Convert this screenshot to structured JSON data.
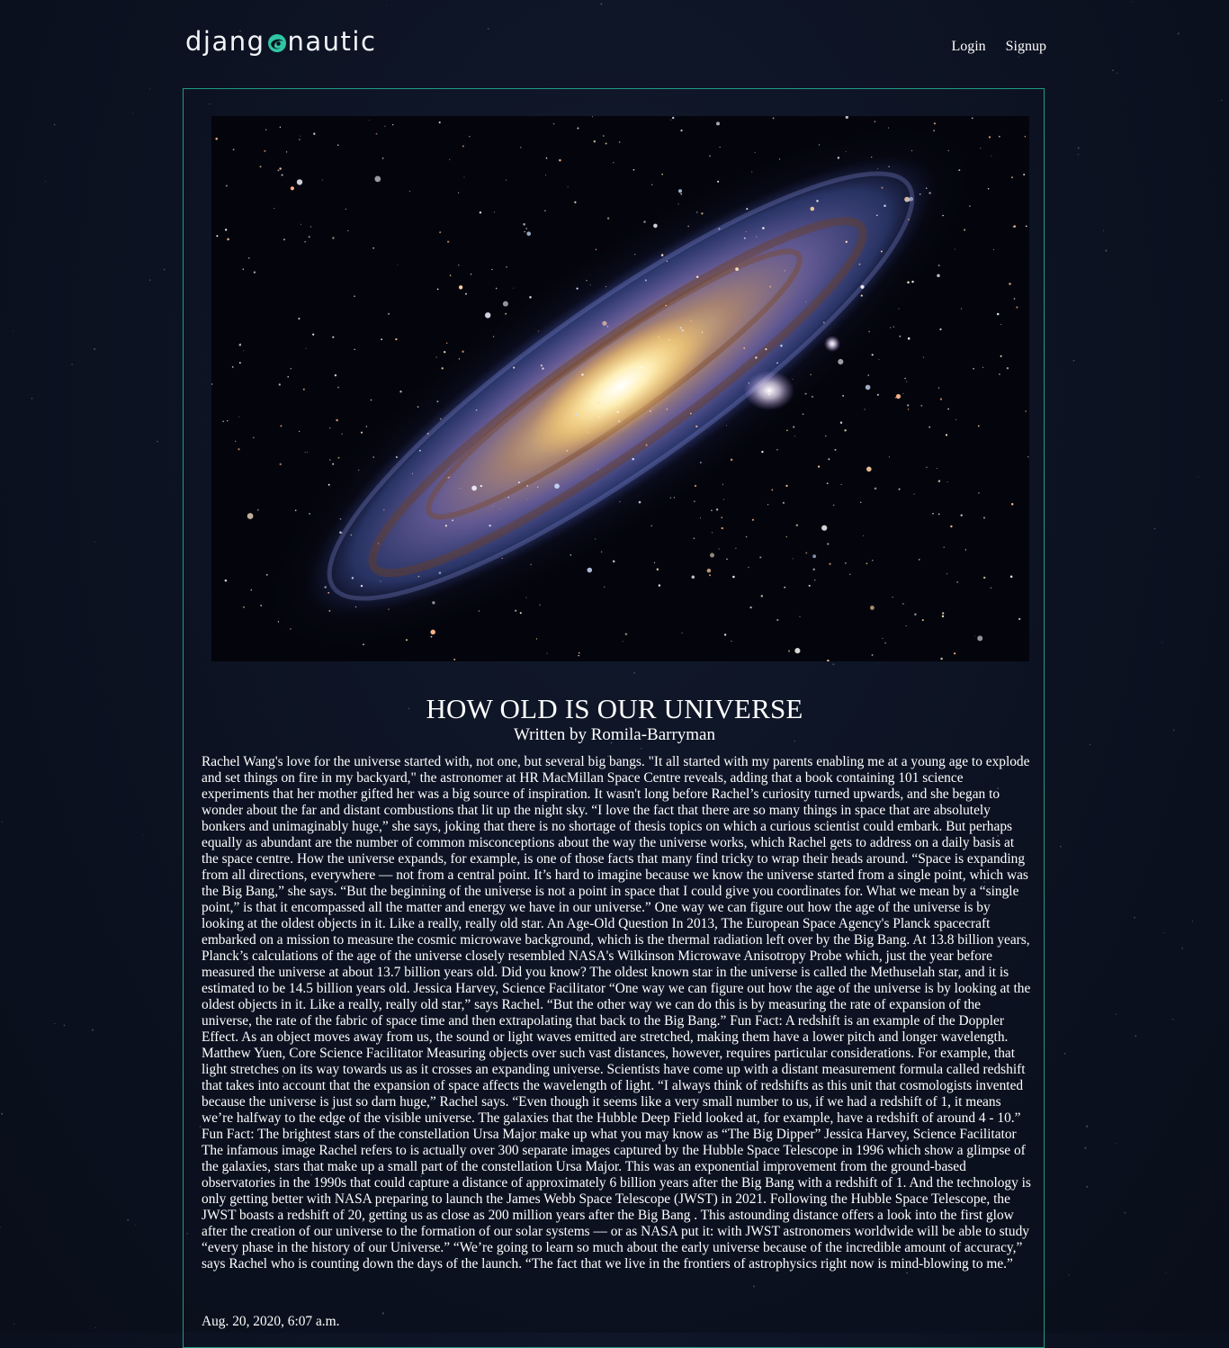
{
  "site": {
    "logo_text_left": "djang",
    "logo_text_right": "nautic",
    "logo_icon": "swirl-orb-icon",
    "accent_color": "#1f9c86"
  },
  "nav": {
    "login": "Login",
    "signup": "Signup"
  },
  "post": {
    "hero_image": "andromeda-galaxy-image",
    "title": "HOW OLD IS OUR UNIVERSE",
    "byline": "Written by Romila-Barryman",
    "body": "Rachel Wang's love for the universe started with, not one, but several big bangs. \"It all started with my parents enabling me at a young age to explode and set things on fire in my backyard,\" the astronomer at HR MacMillan Space Centre reveals, adding that a book containing 101 science experiments that her mother gifted her was a big source of inspiration. It wasn't long before Rachel’s curiosity turned upwards, and she began to wonder about the far and distant combustions that lit up the night sky. “I love the fact that there are so many things in space that are absolutely bonkers and unimaginably huge,” she says, joking that there is no shortage of thesis topics on which a curious scientist could embark. But perhaps equally as abundant are the number of common misconceptions about the way the universe works, which Rachel gets to address on a daily basis at the space centre. How the universe expands, for example, is one of those facts that many find tricky to wrap their heads around. “Space is expanding from all directions, everywhere — not from a central point. It’s hard to imagine because we know the universe started from a single point, which was the Big Bang,” she says. “But the beginning of the universe is not a point in space that I could give you coordinates for. What we mean by a “single point,” is that it encompassed all the matter and energy we have in our universe.” One way we can figure out how the age of the universe is by looking at the oldest objects in it. Like a really, really old star. An Age-Old Question In 2013, The European Space Agency's Planck spacecraft embarked on a mission to measure the cosmic microwave background, which is the thermal radiation left over by the Big Bang. At 13.8 billion years, Planck’s calculations of the age of the universe closely resembled NASA's Wilkinson Microwave Anisotropy Probe which, just the year before measured the universe at about 13.7 billion years old. Did you know? The oldest known star in the universe is called the Methuselah star, and it is estimated to be 14.5 billion years old. Jessica Harvey, Science Facilitator “One way we can figure out how the age of the universe is by looking at the oldest objects in it. Like a really, really old star,” says Rachel. “But the other way we can do this is by measuring the rate of expansion of the universe, the rate of the fabric of space time and then extrapolating that back to the Big Bang.” Fun Fact: A redshift is an example of the Doppler Effect. As an object moves away from us, the sound or light waves emitted are stretched, making them have a lower pitch and longer wavelength. Matthew Yuen, Core Science Facilitator Measuring objects over such vast distances, however, requires particular considerations. For example, that light stretches on its way towards us as it crosses an expanding universe. Scientists have come up with a distant measurement formula called redshift that takes into account that the expansion of space affects the wavelength of light. “I always think of redshifts as this unit that cosmologists invented because the universe is just so darn huge,” Rachel says. “Even though it seems like a very small number to us, if we had a redshift of 1, it means we’re halfway to the edge of the visible universe. The galaxies that the Hubble Deep Field looked at, for example, have a redshift of around 4 - 10.” Fun Fact: The brightest stars of the constellation Ursa Major make up what you may know as “The Big Dipper” Jessica Harvey, Science Facilitator The infamous image Rachel refers to is actually over 300 separate images captured by the Hubble Space Telescope in 1996 which show a glimpse of the galaxies, stars that make up a small part of the constellation Ursa Major. This was an exponential improvement from the ground-based observatories in the 1990s that could capture a distance of approximately 6 billion years after the Big Bang with a redshift of 1. And the technology is only getting better with NASA preparing to launch the James Webb Space Telescope (JWST) in 2021. Following the Hubble Space Telescope, the JWST boasts a redshift of 20, getting us as close as 200 million years after the Big Bang . This astounding distance offers a look into the first glow after the creation of our universe to the formation of our solar systems — or as NASA put it: with JWST astronomers worldwide will be able to study “every phase in the history of our Universe.” “We’re going to learn so much about the early universe because of the incredible amount of accuracy,” says Rachel who is counting down the days of the launch. “The fact that we live in the frontiers of astrophysics right now is mind-blowing to me.”",
    "date": "Aug. 20, 2020, 6:07 a.m."
  }
}
